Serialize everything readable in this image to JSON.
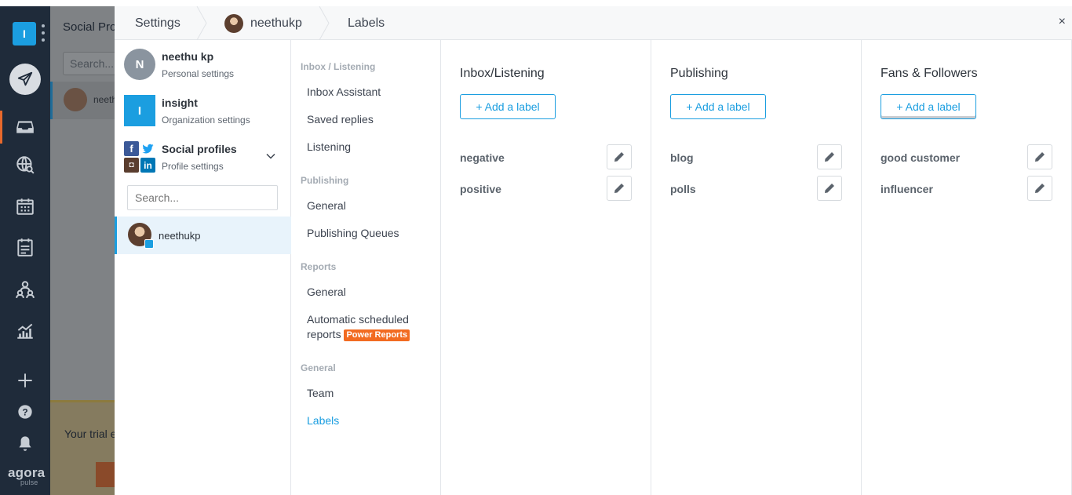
{
  "app": {
    "workspace_initial": "I",
    "brand_name": "agora",
    "brand_sub": "pulse",
    "nav_icons": [
      "compose-icon",
      "inbox-icon",
      "listening-icon",
      "calendar-icon",
      "publishing-list-icon",
      "users-icon",
      "reports-icon",
      "add-icon",
      "help-icon",
      "bell-icon"
    ]
  },
  "background": {
    "title": "Social Profiles",
    "search_placeholder": "Search...",
    "profile_name": "neethukp",
    "trial_text": "Your trial ends"
  },
  "header": {
    "crumb_settings": "Settings",
    "crumb_profile": "neethukp",
    "crumb_page": "Labels",
    "close": "×"
  },
  "accounts": {
    "personal": {
      "initial": "N",
      "name": "neethu kp",
      "sub": "Personal settings"
    },
    "organization": {
      "initial": "I",
      "name": "insight",
      "sub": "Organization settings"
    },
    "social": {
      "name": "Social profiles",
      "sub": "Profile settings",
      "icon_letters": {
        "facebook": "f",
        "instagram": "◘",
        "linkedin": "in"
      }
    },
    "search_placeholder": "Search...",
    "selected_profile": "neethukp"
  },
  "menu": {
    "sections": [
      {
        "title": "Inbox / Listening",
        "items": [
          "Inbox Assistant",
          "Saved replies",
          "Listening"
        ]
      },
      {
        "title": "Publishing",
        "items": [
          "General",
          "Publishing Queues"
        ]
      },
      {
        "title": "Reports",
        "items": [
          "General",
          "Automatic scheduled",
          "reports"
        ]
      },
      {
        "title": "General",
        "items": [
          "Team",
          "Labels"
        ]
      }
    ],
    "power_badge": "Power Reports",
    "active_item": "Labels"
  },
  "label_columns": [
    {
      "title": "Inbox/Listening",
      "add_label": "+ Add a label",
      "labels": [
        "negative",
        "positive"
      ]
    },
    {
      "title": "Publishing",
      "add_label": "+ Add a label",
      "labels": [
        "blog",
        "polls"
      ]
    },
    {
      "title": "Fans & Followers",
      "add_label": "+ Add a label",
      "labels": [
        "good customer",
        "influencer"
      ]
    }
  ],
  "colors": {
    "accent": "#1b9ee0",
    "sidebar": "#1f2b3a",
    "power_badge": "#f26b21",
    "active_nav": "#e8692c"
  }
}
